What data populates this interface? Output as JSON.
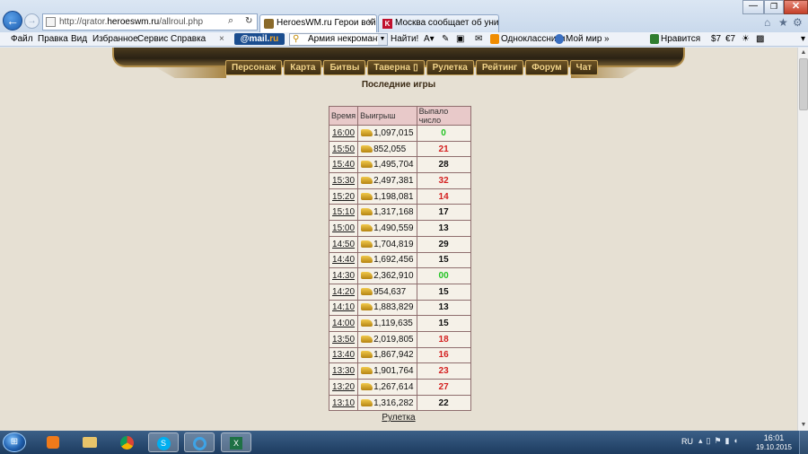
{
  "browser": {
    "url_prefix": "http://qrator.",
    "url_domain": "heroeswm.ru",
    "url_suffix": "/allroul.php",
    "back_glyph": "←",
    "forward_glyph": "→",
    "tabs": [
      {
        "label": "HeroesWM.ru Герои войн...",
        "close": "×"
      },
      {
        "label": "Москва сообщает об уничто...",
        "close": "",
        "favicon_letter": "K"
      }
    ]
  },
  "menu": {
    "items": [
      "Файл",
      "Правка",
      "Вид",
      "Избранное",
      "Сервис",
      "Справка"
    ],
    "close_glyph": "×"
  },
  "toolbar": {
    "mailru_prefix": "@mail.",
    "mailru_suffix": "ru",
    "search_value": "Армия некромантов",
    "find_label": "Найти!",
    "odnoklassniki": "Одноклассники",
    "moy_mir": "Мой мир",
    "more_glyph": "»",
    "like_label": "Нравится",
    "currency_usd": "$7",
    "currency_eur": "€7"
  },
  "game": {
    "nav": [
      "Персонаж",
      "Карта",
      "Битвы",
      "Таверна",
      "Рулетка",
      "Рейтинг",
      "Форум",
      "Чат"
    ],
    "tavern_flag": "▯",
    "title": "Последние игры",
    "columns": [
      "Время",
      "Выигрыш",
      "Выпало число"
    ],
    "rows": [
      {
        "time": "16:00",
        "win": "1,097,015",
        "num": "0"
      },
      {
        "time": "15:50",
        "win": "852,055",
        "num": "21"
      },
      {
        "time": "15:40",
        "win": "1,495,704",
        "num": "28"
      },
      {
        "time": "15:30",
        "win": "2,497,381",
        "num": "32"
      },
      {
        "time": "15:20",
        "win": "1,198,081",
        "num": "14"
      },
      {
        "time": "15:10",
        "win": "1,317,168",
        "num": "17"
      },
      {
        "time": "15:00",
        "win": "1,490,559",
        "num": "13"
      },
      {
        "time": "14:50",
        "win": "1,704,819",
        "num": "29"
      },
      {
        "time": "14:40",
        "win": "1,692,456",
        "num": "15"
      },
      {
        "time": "14:30",
        "win": "2,362,910",
        "num": "00"
      },
      {
        "time": "14:20",
        "win": "954,637",
        "num": "15"
      },
      {
        "time": "14:10",
        "win": "1,883,829",
        "num": "13"
      },
      {
        "time": "14:00",
        "win": "1,119,635",
        "num": "15"
      },
      {
        "time": "13:50",
        "win": "2,019,805",
        "num": "18"
      },
      {
        "time": "13:40",
        "win": "1,867,942",
        "num": "16"
      },
      {
        "time": "13:30",
        "win": "1,901,764",
        "num": "23"
      },
      {
        "time": "13:20",
        "win": "1,267,614",
        "num": "27"
      },
      {
        "time": "13:10",
        "win": "1,316,282",
        "num": "22"
      }
    ],
    "footer_link": "Рулетка"
  },
  "roulette_colors": {
    "zero": "#22c322",
    "red": "#d42020",
    "black": "#111111",
    "red_numbers": [
      "1",
      "3",
      "5",
      "7",
      "9",
      "12",
      "14",
      "16",
      "18",
      "19",
      "21",
      "23",
      "25",
      "27",
      "30",
      "32",
      "34",
      "36"
    ]
  },
  "taskbar": {
    "skype_letter": "S",
    "excel_letter": "X",
    "lang": "RU",
    "time": "16:01",
    "date": "19.10.2015"
  }
}
